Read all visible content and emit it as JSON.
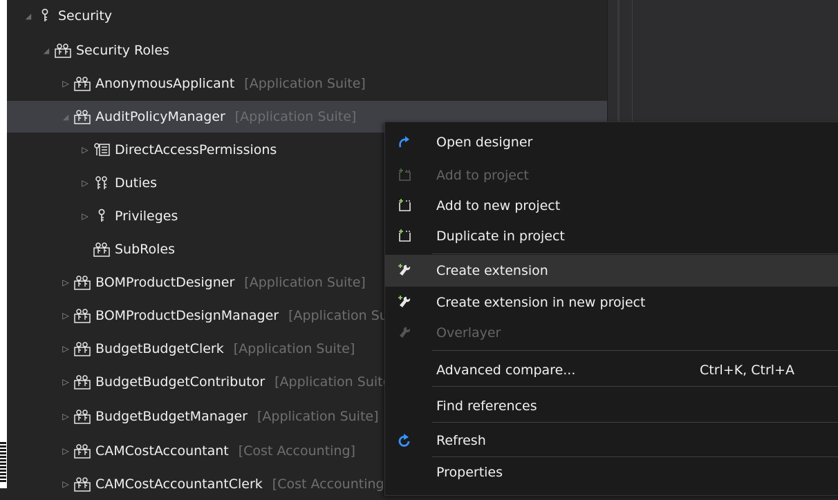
{
  "tree": {
    "model_tag_text": "[Application Suite]",
    "nodes": [
      {
        "label": "Security",
        "icon": "privilege-key-icon"
      },
      {
        "label": "Security Roles",
        "icon": "security-role-icon"
      },
      {
        "label": "AnonymousApplicant",
        "tag": "[Application Suite]",
        "icon": "security-role-icon"
      },
      {
        "label": "AuditPolicyManager",
        "tag": "[Application Suite]",
        "icon": "security-role-icon"
      },
      {
        "label": "DirectAccessPermissions",
        "icon": "permissions-grid-icon"
      },
      {
        "label": "Duties",
        "icon": "duty-key-icon"
      },
      {
        "label": "Privileges",
        "icon": "privilege-key-icon"
      },
      {
        "label": "SubRoles",
        "icon": "security-role-icon"
      },
      {
        "label": "BOMProductDesigner",
        "tag": "[Application Suite]",
        "icon": "security-role-icon"
      },
      {
        "label": "BOMProductDesignManager",
        "tag": "[Application Suite]",
        "icon": "security-role-icon"
      },
      {
        "label": "BudgetBudgetClerk",
        "tag": "[Application Suite]",
        "icon": "security-role-icon"
      },
      {
        "label": "BudgetBudgetContributor",
        "tag": "[Application Suite]",
        "icon": "security-role-icon"
      },
      {
        "label": "BudgetBudgetManager",
        "tag": "[Application Suite]",
        "icon": "security-role-icon"
      },
      {
        "label": "CAMCostAccountant",
        "tag": "[Cost Accounting]",
        "icon": "security-role-icon"
      },
      {
        "label": "CAMCostAccountantClerk",
        "tag": "[Cost Accounting]",
        "icon": "security-role-icon"
      }
    ]
  },
  "context_menu": {
    "items": [
      {
        "label": "Open designer",
        "icon": "redo-arrow-icon",
        "enabled": true
      },
      {
        "label": "Add to project",
        "icon": "add-to-project-icon",
        "enabled": false
      },
      {
        "label": "Add to new project",
        "icon": "add-to-project-icon",
        "enabled": true
      },
      {
        "label": "Duplicate in project",
        "icon": "add-to-project-icon",
        "enabled": true
      },
      {
        "label": "Create extension",
        "icon": "wrench-plus-icon",
        "enabled": true
      },
      {
        "label": "Create extension in new project",
        "icon": "wrench-plus-icon",
        "enabled": true
      },
      {
        "label": "Overlayer",
        "icon": "wrench-icon",
        "enabled": false
      },
      {
        "label": "Advanced compare...",
        "shortcut": "Ctrl+K, Ctrl+A",
        "enabled": true
      },
      {
        "label": "Find references",
        "enabled": true
      },
      {
        "label": "Refresh",
        "icon": "refresh-icon",
        "enabled": true
      },
      {
        "label": "Properties",
        "enabled": true
      }
    ]
  },
  "colors": {
    "background": "#252526",
    "selected_row": "#3f3f46",
    "menu_background": "#1b1b1c",
    "menu_hover": "#333334",
    "accent_blue": "#3794ff",
    "accent_green": "#8fd16a",
    "muted_text": "#6f6f6f"
  }
}
